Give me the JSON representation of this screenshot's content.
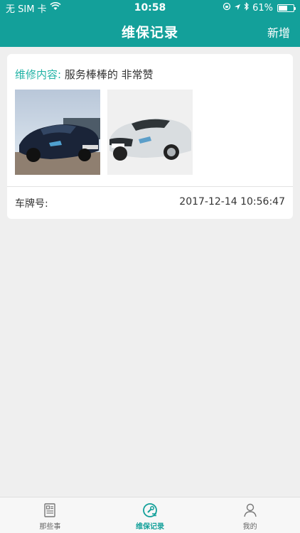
{
  "status_bar": {
    "carrier": "无 SIM 卡",
    "time": "10:58",
    "battery_percent": "61%",
    "battery_level": 0.61
  },
  "nav": {
    "title": "维保记录",
    "action": "新增"
  },
  "record": {
    "content_label": "维修内容:",
    "content_value": "服务棒棒的 非常赞",
    "plate_label": "车牌号:",
    "timestamp": "2017-12-14 10:56:47",
    "photos": [
      "car-photo-dark-blue-bmw-i8",
      "car-photo-white-bmw-i8"
    ]
  },
  "tabs": [
    {
      "label": "那些事",
      "icon": "document-icon"
    },
    {
      "label": "维保记录",
      "icon": "wrench-icon"
    },
    {
      "label": "我的",
      "icon": "person-icon"
    }
  ],
  "colors": {
    "accent": "#13a09a",
    "label_green": "#22b3a6",
    "background": "#efefef"
  }
}
